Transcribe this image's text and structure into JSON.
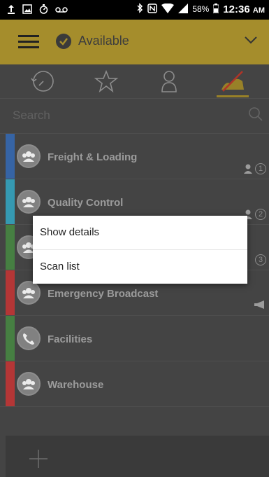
{
  "status_bar": {
    "battery": "58%",
    "time": "12:36",
    "ampm": "AM"
  },
  "header": {
    "status": "Available"
  },
  "tabs": [
    {
      "icon": "history-icon"
    },
    {
      "icon": "star-icon"
    },
    {
      "icon": "person-icon"
    },
    {
      "icon": "channels-icon",
      "active": true
    }
  ],
  "search": {
    "placeholder": "Search"
  },
  "channels": [
    {
      "name": "Freight & Loading",
      "color": "#3b6db3",
      "badge": "1"
    },
    {
      "name": "Quality Control",
      "color": "#3aa7c2",
      "badge": "2"
    },
    {
      "name": "",
      "color": "#4d8a48",
      "badge": "3"
    },
    {
      "name": "Emergency Broadcast",
      "color": "#c43b3b"
    },
    {
      "name": "Facilities",
      "color": "#4d8a48"
    },
    {
      "name": "Warehouse",
      "color": "#c43b3b"
    }
  ],
  "popup": {
    "items": [
      "Show details",
      "Scan list"
    ]
  },
  "colors": {
    "accent": "#a58d2c",
    "background": "#4a4a4a"
  }
}
